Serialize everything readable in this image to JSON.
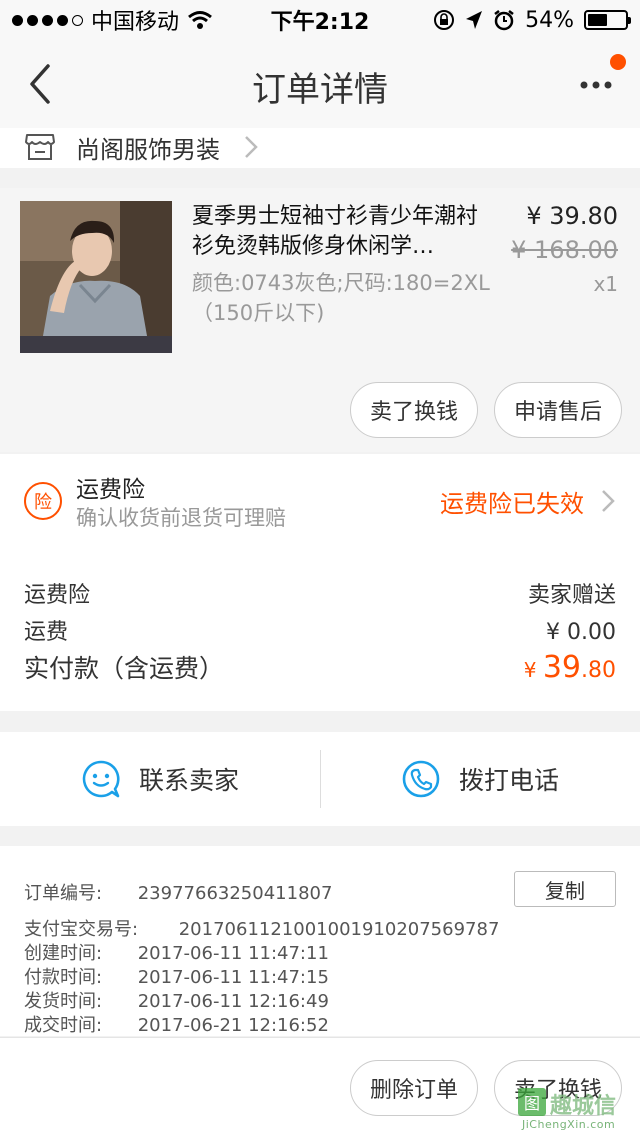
{
  "status_bar": {
    "carrier": "中国移动",
    "time": "下午2:12",
    "battery": "54%",
    "battery_level": 0.54
  },
  "nav": {
    "title": "订单详情",
    "badge_color": "#ff5000"
  },
  "shop": {
    "name": "尚阁服饰男装"
  },
  "item": {
    "title": "夏季男士短袖寸衫青少年潮衬衫免烫韩版修身休闲学…",
    "sku": "颜色:0743灰色;尺码:180=2XL（150斤以下)",
    "price": "¥ 39.80",
    "original_price": "¥ 168.00",
    "quantity": "x1",
    "actions": [
      "卖了换钱",
      "申请售后"
    ]
  },
  "insurance": {
    "icon_label": "险",
    "title": "运费险",
    "subtitle": "确认收货前退货可理赔",
    "status": "运费险已失效"
  },
  "fees": {
    "insurance_label": "运费险",
    "insurance_value": "卖家赠送",
    "shipping_label": "运费",
    "shipping_value": "¥ 0.00",
    "total_label": "实付款（含运费）",
    "total_currency": "¥ ",
    "total_int": "39",
    "total_dec": ".80"
  },
  "contact": {
    "seller": "联系卖家",
    "phone": "拨打电话"
  },
  "order_info": {
    "order_no_label": "订单编号:",
    "order_no": "23977663250411807",
    "copy_button": "复制",
    "alipay_label": "支付宝交易号:",
    "alipay_no": "2017061121001001910207569787",
    "created_label": "创建时间:",
    "created": "2017-06-11 11:47:11",
    "paid_label": "付款时间:",
    "paid": "2017-06-11 11:47:15",
    "shipped_label": "发货时间:",
    "shipped": "2017-06-11 12:16:49",
    "completed_label": "成交时间:",
    "completed": "2017-06-21 12:16:52"
  },
  "bottom_actions": [
    "删除订单",
    "卖了换钱"
  ],
  "watermark": {
    "box": "图",
    "text": "趣城信",
    "url": "JiChengXin.com"
  },
  "colors": {
    "accent": "#ff5000",
    "icon_blue": "#1aa0e8"
  }
}
